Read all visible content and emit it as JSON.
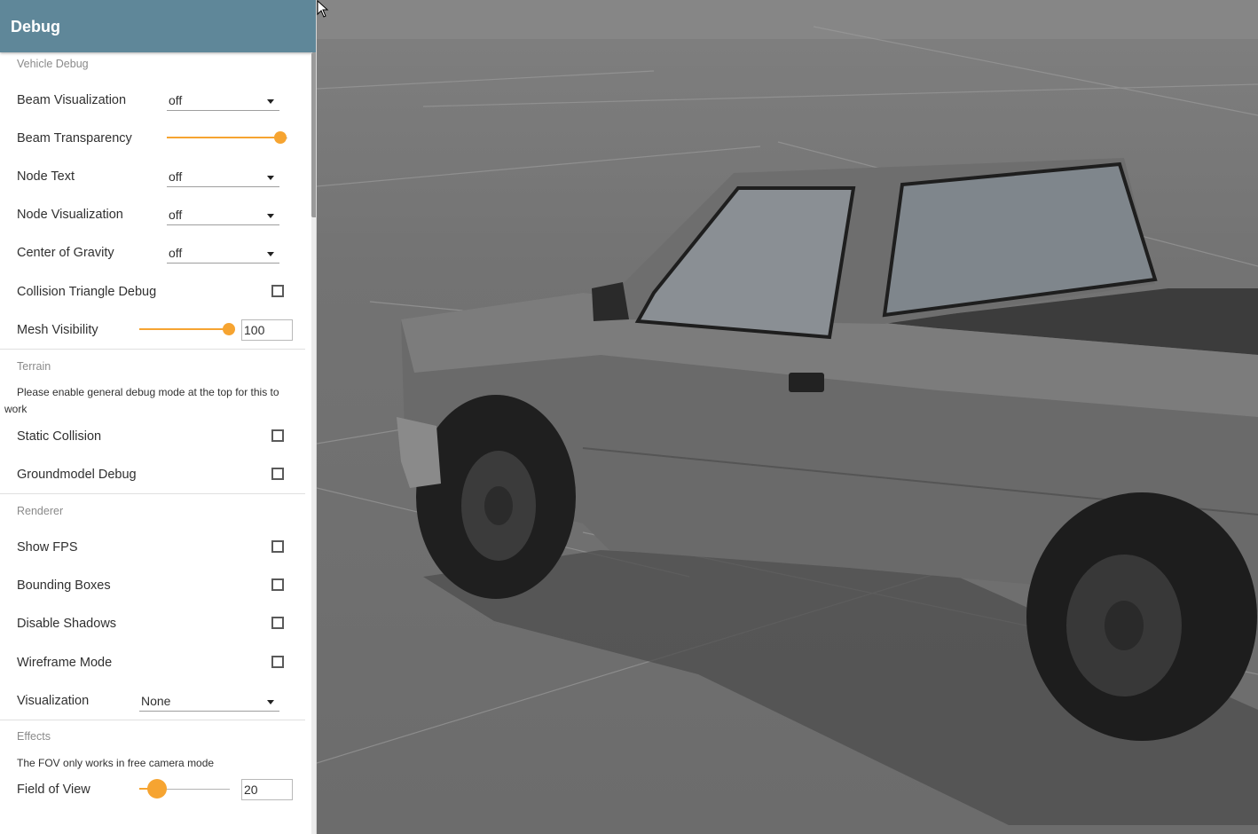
{
  "panel": {
    "title": "Debug",
    "sections": {
      "vehicle": {
        "title": "Vehicle Debug",
        "beam_visualization": {
          "label": "Beam Visualization",
          "value": "off"
        },
        "beam_transparency": {
          "label": "Beam Transparency",
          "value_fraction": 1.0
        },
        "node_text": {
          "label": "Node Text",
          "value": "off"
        },
        "node_visualization": {
          "label": "Node Visualization",
          "value": "off"
        },
        "center_of_gravity": {
          "label": "Center of Gravity",
          "value": "off"
        },
        "collision_triangle_debug": {
          "label": "Collision Triangle Debug",
          "checked": false
        },
        "mesh_visibility": {
          "label": "Mesh Visibility",
          "value": "100",
          "value_fraction": 1.0
        }
      },
      "terrain": {
        "title": "Terrain",
        "note": "Please enable general debug mode at the top for this to work",
        "static_collision": {
          "label": "Static Collision",
          "checked": false
        },
        "groundmodel_debug": {
          "label": "Groundmodel Debug",
          "checked": false
        }
      },
      "renderer": {
        "title": "Renderer",
        "show_fps": {
          "label": "Show FPS",
          "checked": false
        },
        "bounding_boxes": {
          "label": "Bounding Boxes",
          "checked": false
        },
        "disable_shadows": {
          "label": "Disable Shadows",
          "checked": false
        },
        "wireframe_mode": {
          "label": "Wireframe Mode",
          "checked": false
        },
        "visualization": {
          "label": "Visualization",
          "value": "None"
        }
      },
      "effects": {
        "title": "Effects",
        "note": "The FOV only works in free camera mode",
        "field_of_view": {
          "label": "Field of View",
          "value": "20",
          "value_fraction": 0.2
        }
      }
    }
  },
  "colors": {
    "header": "#5f8799",
    "accent": "#f6a431"
  }
}
